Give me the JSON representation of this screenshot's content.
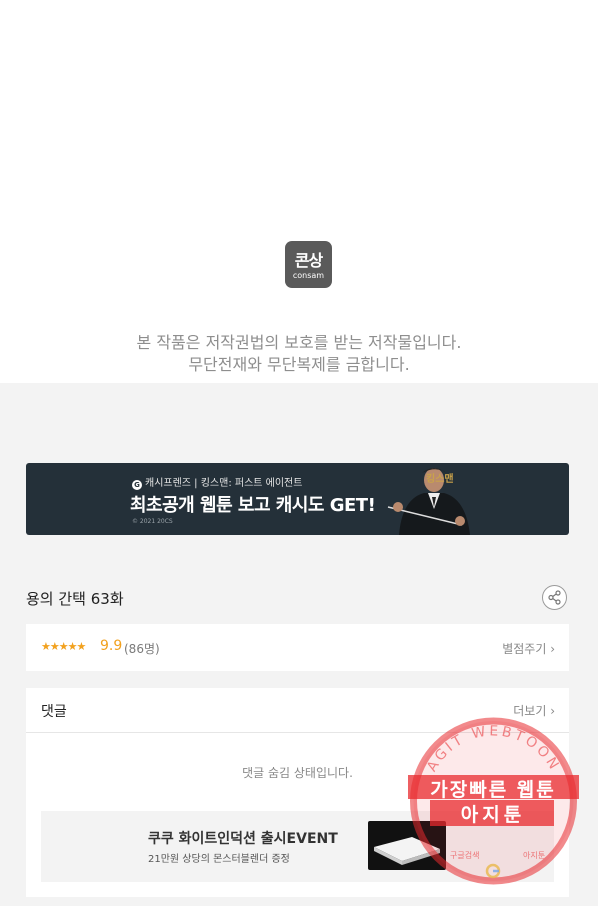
{
  "viewer": {
    "logo_ko": "콘상",
    "logo_en": "consam",
    "notice_line1": "본 작품은 저작권법의 보호를 받는 저작물입니다.",
    "notice_line2": "무단전재와 무단복제를 금합니다."
  },
  "banner": {
    "brand": "캐시프렌즈 | 킹스맨: 퍼스트 에이전트",
    "brand_icon": "G",
    "headline": "최초공개 웹툰 보고 캐시도 GET!",
    "copyright": "© 2021 20CS",
    "kingsman_logo": "킹스맨"
  },
  "episode": {
    "title": "용의 간택 63화",
    "share_icon": "share-icon"
  },
  "rating": {
    "stars": "★★★★★",
    "score": "9.9",
    "count": "(86명)",
    "rate_button": "별점주기"
  },
  "comments": {
    "header": "댓글",
    "more": "더보기",
    "hidden_message": "댓글 숨김 상태입니다."
  },
  "ad": {
    "title": "쿠쿠 화이트인덕션 출시EVENT",
    "subtitle": "21만원 상당의 몬스터블렌더 증정"
  },
  "watermark": {
    "ring_text": "AGIT WEBTOON",
    "line1": "가장빠른 웹툰",
    "line2": "아지툰",
    "small_left": "구글검색",
    "small_right": "아지툰"
  },
  "colors": {
    "accent_orange": "#f2a11e",
    "banner_bg": "#243039",
    "watermark_red": "#e8292d"
  }
}
